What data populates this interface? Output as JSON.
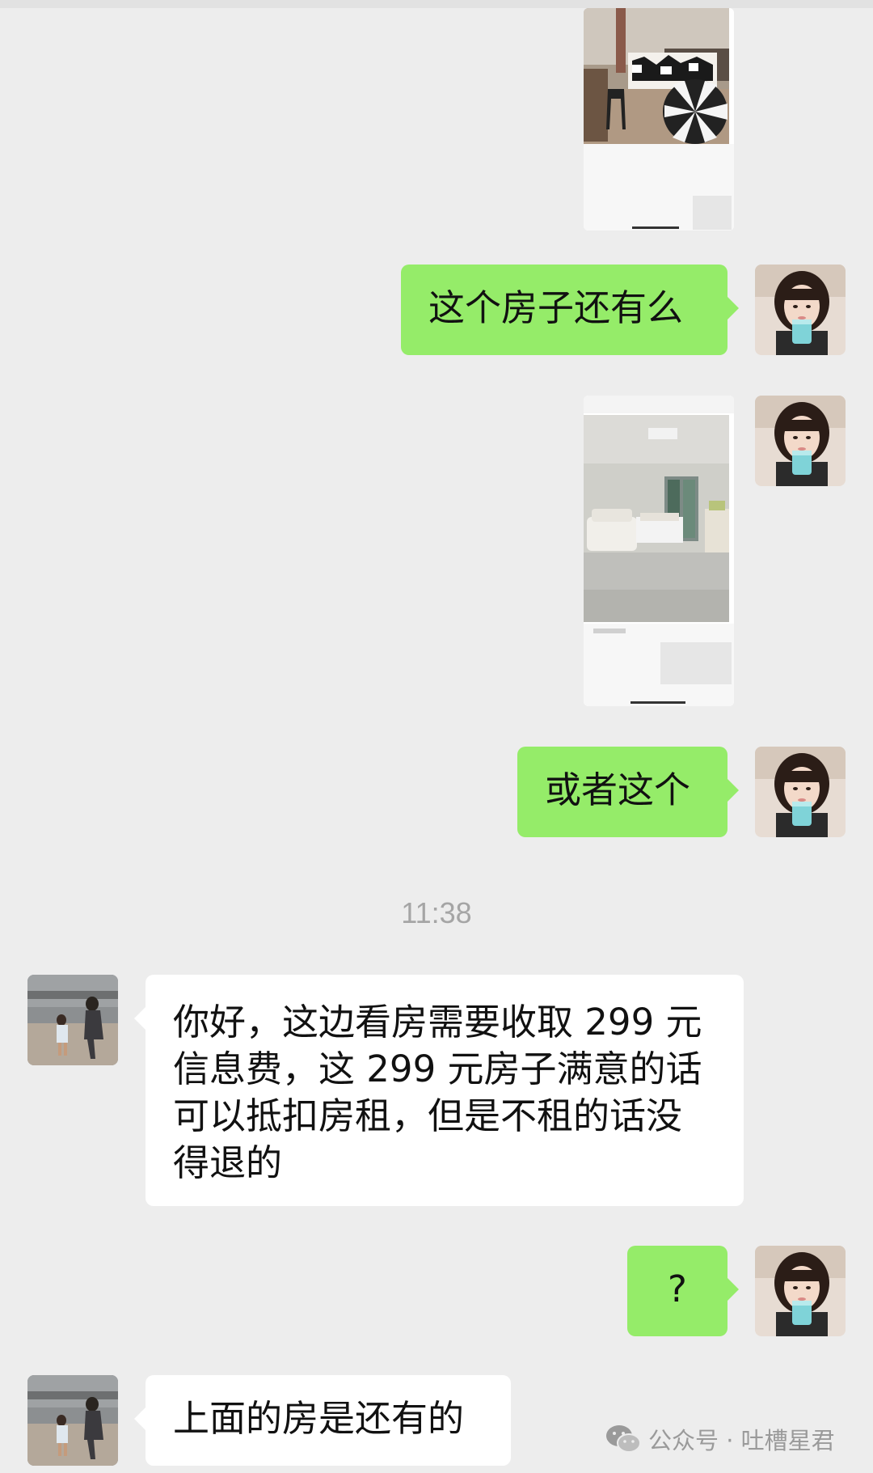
{
  "chat": {
    "timestamp": "11:38",
    "messages": [
      {
        "id": "m1",
        "side": "right",
        "kind": "image",
        "image_desc": "bedroom-listing-screenshot"
      },
      {
        "id": "m2",
        "side": "right",
        "kind": "text",
        "text": "这个房子还有么"
      },
      {
        "id": "m3",
        "side": "right",
        "kind": "image",
        "image_desc": "living-room-listing-screenshot"
      },
      {
        "id": "m4",
        "side": "right",
        "kind": "text",
        "text": "或者这个"
      },
      {
        "id": "m5",
        "side": "left",
        "kind": "text",
        "lines": [
          "你好，这边看房需要收取 299 元",
          "信息费，这 299 元房子满意的话",
          "可以抵扣房租，但是不租的话没",
          "得退的"
        ]
      },
      {
        "id": "m6",
        "side": "right",
        "kind": "text",
        "text": "?"
      },
      {
        "id": "m7",
        "side": "left",
        "kind": "text",
        "text": "上面的房是还有的"
      }
    ]
  },
  "watermark": {
    "text": "公众号 · 吐槽星君",
    "icon": "wechat-icon"
  },
  "colors": {
    "background": "#ededed",
    "sent_bubble": "#95ec69",
    "received_bubble": "#ffffff",
    "timestamp": "#a5a5a5"
  }
}
